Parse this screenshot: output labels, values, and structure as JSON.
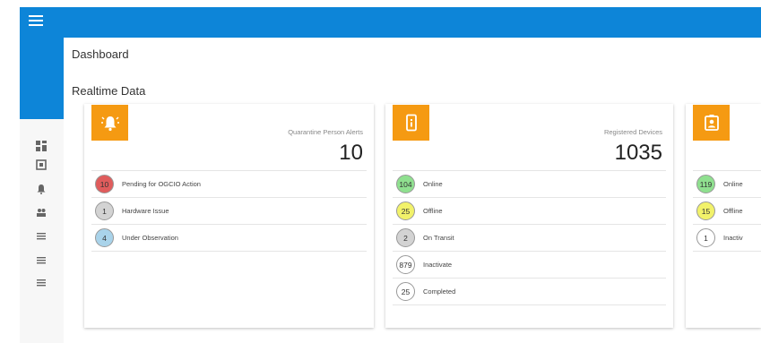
{
  "header": {
    "menu_icon": "hamburger-icon",
    "brand_color": "#0d85d8"
  },
  "sidebar": {
    "icons": [
      "dashboard-icon",
      "id-card-icon",
      "bell-icon",
      "people-icon",
      "list-icon",
      "list-icon",
      "list-icon"
    ]
  },
  "page": {
    "title": "Dashboard",
    "section": "Realtime Data"
  },
  "cards": [
    {
      "icon": "bell-alarm-icon",
      "label": "Quarantine Person Alerts",
      "count": "10",
      "rows": [
        {
          "badge": "10",
          "label": "Pending for OGCIO Action",
          "color": "#e05c5c"
        },
        {
          "badge": "1",
          "label": "Hardware Issue",
          "color": "#d3d3d3"
        },
        {
          "badge": "4",
          "label": "Under Observation",
          "color": "#a9d3ea"
        }
      ]
    },
    {
      "icon": "device-icon",
      "label": "Registered Devices",
      "count": "1035",
      "rows": [
        {
          "badge": "104",
          "label": "Online",
          "color": "#8fe08f"
        },
        {
          "badge": "25",
          "label": "Offline",
          "color": "#f2f26a"
        },
        {
          "badge": "2",
          "label": "On Transit",
          "color": "#d3d3d3"
        },
        {
          "badge": "879",
          "label": "Inactivate",
          "color": "#ffffff"
        },
        {
          "badge": "25",
          "label": "Completed",
          "color": "#ffffff"
        }
      ]
    },
    {
      "icon": "badge-person-icon",
      "rows": [
        {
          "badge": "119",
          "label": "Online",
          "color": "#8fe08f"
        },
        {
          "badge": "15",
          "label": "Offline",
          "color": "#f2f26a"
        },
        {
          "badge": "1",
          "label": "Inactiv",
          "color": "#ffffff"
        }
      ]
    }
  ],
  "colors": {
    "accent_orange": "#f59a12",
    "sidebar_bg": "#f7f7f7"
  }
}
